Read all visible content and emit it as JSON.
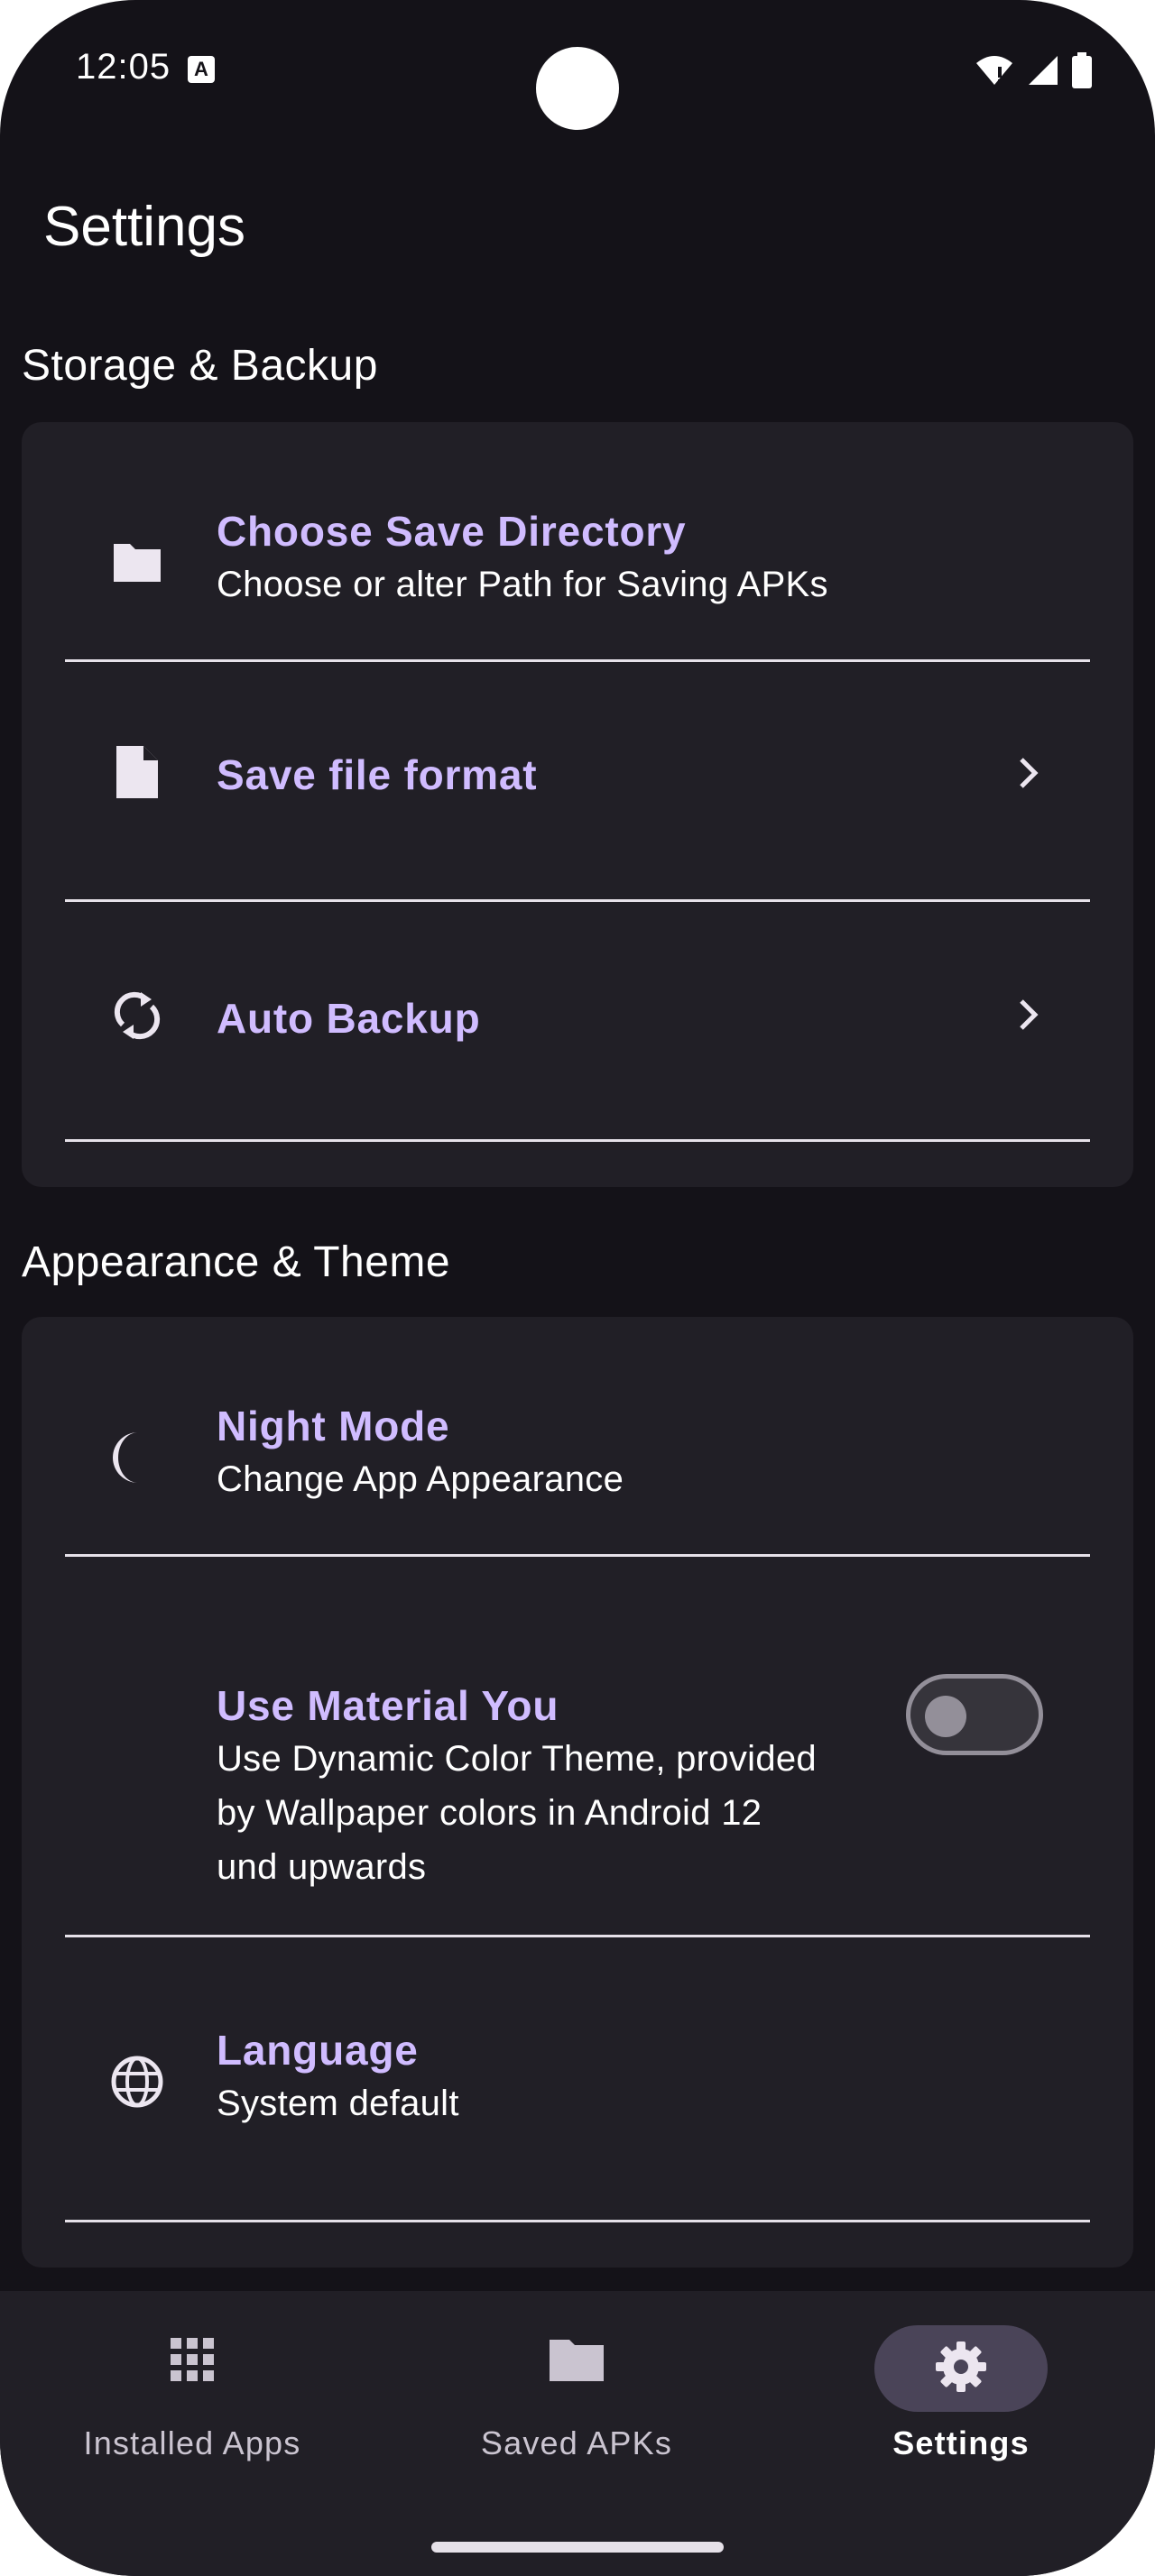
{
  "status_bar": {
    "time": "12:05",
    "badge": "A"
  },
  "page": {
    "title": "Settings"
  },
  "sections": [
    {
      "title": "Storage & Backup",
      "items": [
        {
          "title": "Choose Save Directory",
          "subtitle": "Choose or alter Path for Saving APKs",
          "icon": "folder-icon"
        },
        {
          "title": "Save file format",
          "icon": "file-icon",
          "trailing": "chevron-right-icon"
        },
        {
          "title": "Auto Backup",
          "icon": "sync-icon",
          "trailing": "chevron-right-icon"
        }
      ]
    },
    {
      "title": "Appearance & Theme",
      "items": [
        {
          "title": "Night Mode",
          "subtitle": "Change App Appearance",
          "icon": "moon-icon"
        },
        {
          "title": "Use Material You",
          "subtitle_lines": [
            "Use Dynamic Color Theme, provided",
            "by Wallpaper colors in Android 12",
            "und upwards"
          ],
          "trailing": "toggle",
          "toggle_on": false
        },
        {
          "title": "Language",
          "subtitle": "System default",
          "icon": "globe-icon"
        }
      ]
    }
  ],
  "nav": {
    "items": [
      {
        "label": "Installed Apps",
        "icon": "apps-grid-icon",
        "active": false
      },
      {
        "label": "Saved APKs",
        "icon": "folder-icon",
        "active": false
      },
      {
        "label": "Settings",
        "icon": "gear-icon",
        "active": true
      }
    ]
  },
  "colors": {
    "background": "#141218",
    "card": "#211f26",
    "accent": "#d0bcff",
    "nav_active_pill": "#4a4458"
  }
}
